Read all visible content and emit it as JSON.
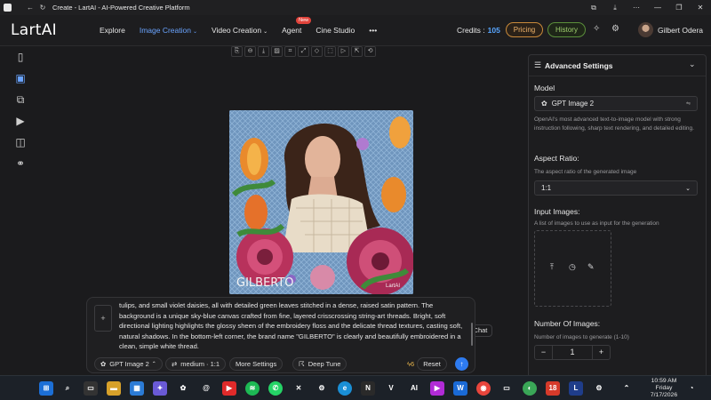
{
  "window": {
    "title": "Create - LartAI - AI-Powered Creative Platform"
  },
  "navbar": {
    "brand": "LartAI",
    "items": [
      {
        "label": "Explore"
      },
      {
        "label": "Image Creation",
        "caret": "⌄"
      },
      {
        "label": "Video Creation",
        "caret": "⌄"
      },
      {
        "label": "Agent",
        "badge": "New"
      },
      {
        "label": "Cine Studio"
      },
      {
        "label": "•••"
      }
    ],
    "credits_label": "Credits :",
    "credits_value": "105",
    "pricing": "Pricing",
    "history": "History",
    "username": "Gilbert Odera"
  },
  "image": {
    "watermark_text": "GILBERTO",
    "corner_text": "LartAI"
  },
  "canvas": {
    "ai_chat": "AI Chat"
  },
  "prompt": {
    "text": "tulips, and small violet daisies, all with detailed green leaves stitched in a dense, raised satin pattern. The background is a unique sky-blue canvas crafted from fine, layered crisscrossing string-art threads. Bright, soft directional lighting highlights the glossy sheen of the embroidery floss and the delicate thread textures, casting soft, natural shadows. In the bottom-left corner, the brand name \"GILBERTO\" is clearly and beautifully embroidered in a clean, simple white thread.",
    "add_symbol": "+",
    "model_chip": "GPT Image 2",
    "quality_chip": "medium · 1:1",
    "more_settings": "More Settings",
    "deep_tune": "Deep Tune",
    "cost": "6",
    "reset": "Reset"
  },
  "settings": {
    "header": "Advanced Settings",
    "model_label": "Model",
    "model_value": "GPT Image 2",
    "model_description": "OpenAI's most advanced text-to-image model with strong instruction following, sharp text rendering, and detailed editing.",
    "aspect_label": "Aspect Ratio:",
    "aspect_sub": "The aspect ratio of the generated image",
    "aspect_value": "1:1",
    "input_images_label": "Input Images:",
    "input_images_sub": "A list of images to use as input for the generation",
    "num_images_label": "Number Of Images:",
    "num_images_sub": "Number of images to generate (1-10)",
    "num_images_value": "1",
    "minus": "−",
    "plus": "+"
  },
  "taskbar": {
    "time": "10:59 AM",
    "day": "Friday",
    "date": "7/17/2026",
    "badge_count": "18"
  }
}
